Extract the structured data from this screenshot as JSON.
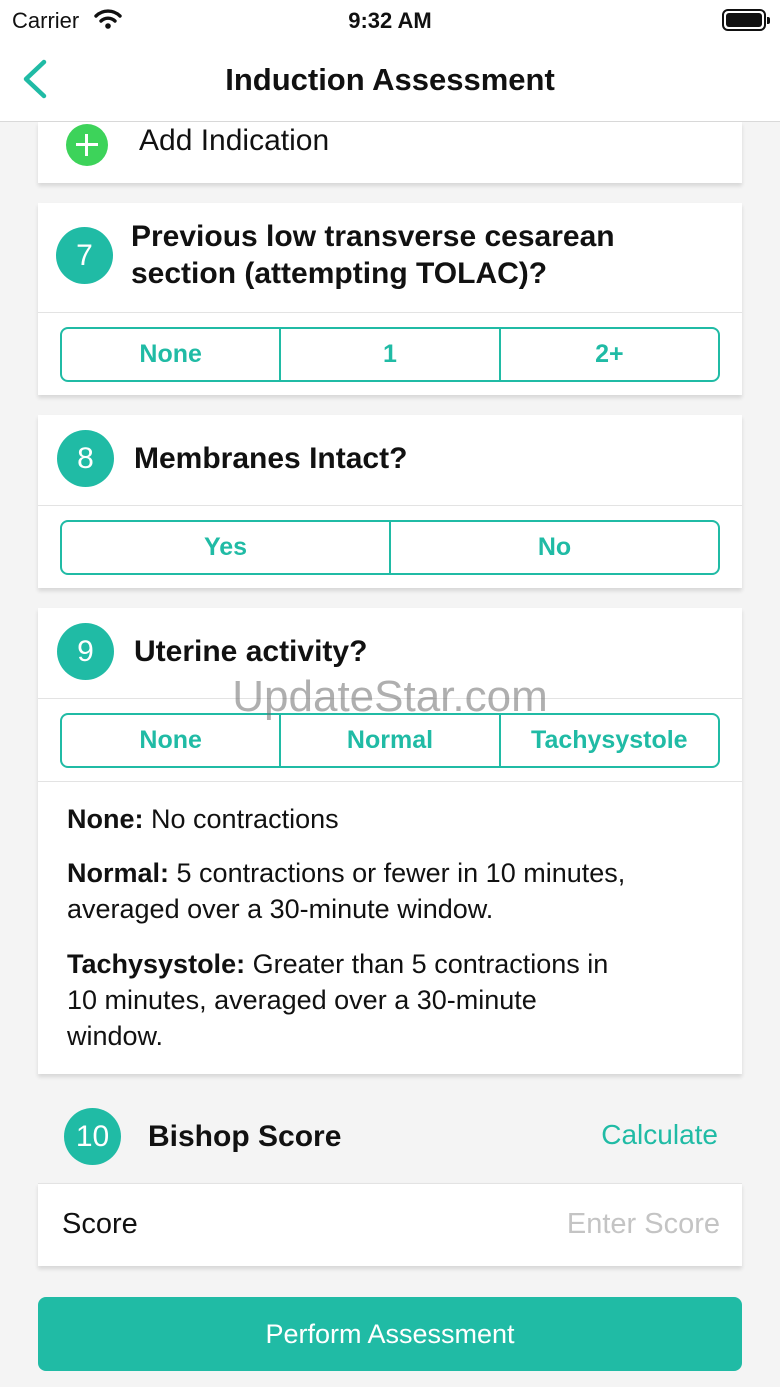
{
  "status_bar": {
    "carrier": "Carrier",
    "time": "9:32 AM"
  },
  "nav": {
    "title": "Induction Assessment",
    "back_icon": "chevron-left-icon"
  },
  "add_indication": {
    "label": "Add Indication",
    "icon": "plus-circle-icon"
  },
  "q7": {
    "number": "7",
    "question_line1": "Previous low transverse cesarean",
    "question_line2": "section (attempting TOLAC)?",
    "options": [
      "None",
      "1",
      "2+"
    ]
  },
  "q8": {
    "number": "8",
    "question": "Membranes Intact?",
    "options": [
      "Yes",
      "No"
    ]
  },
  "q9": {
    "number": "9",
    "question": "Uterine activity?",
    "options": [
      "None",
      "Normal",
      "Tachysystole"
    ],
    "descriptions": [
      {
        "term": "None:",
        "lines": [
          "No contractions"
        ]
      },
      {
        "term": "Normal:",
        "lines": [
          "5 contractions or fewer in 10 minutes,",
          "averaged over a 30-minute window."
        ]
      },
      {
        "term": "Tachysystole:",
        "lines": [
          "Greater than 5 contractions in",
          "10 minutes, averaged over a 30-minute",
          "window."
        ]
      }
    ]
  },
  "q10": {
    "number": "10",
    "title": "Bishop Score",
    "calculate_label": "Calculate",
    "score_label": "Score",
    "score_placeholder": "Enter Score"
  },
  "perform_button": "Perform Assessment",
  "watermark": "UpdateStar.com",
  "colors": {
    "accent": "#20bba5",
    "add_green": "#3dd35a",
    "background": "#f4f4f4"
  }
}
